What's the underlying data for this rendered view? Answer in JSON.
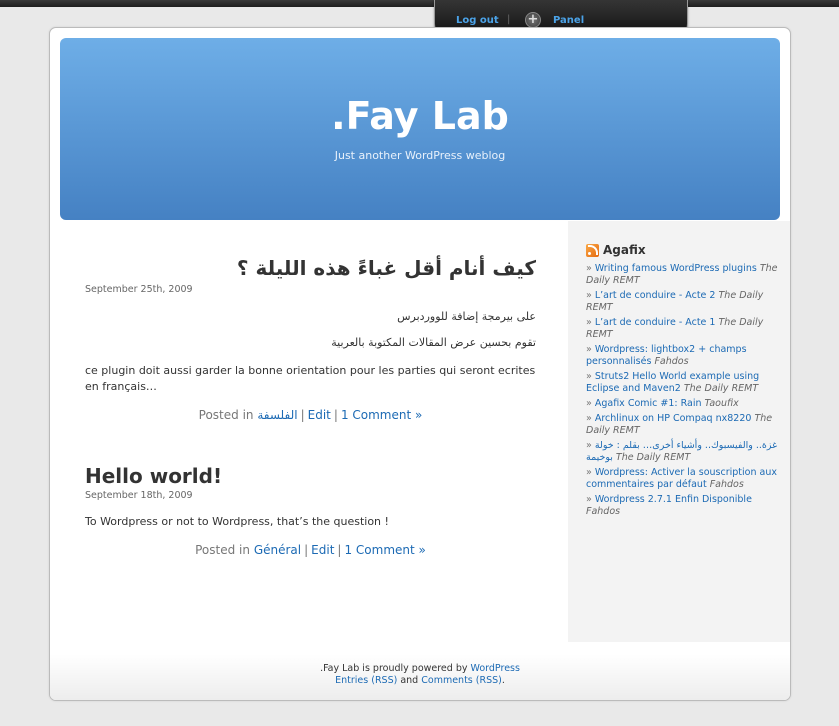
{
  "admin": {
    "logout": "Log out",
    "separator": "|",
    "panel": "Panel"
  },
  "header": {
    "title": ".Fay Lab",
    "description": "Just another WordPress weblog"
  },
  "posts": [
    {
      "title": "كيف أنام أقل غباءً هذه الليلة ؟",
      "date": "September 25th, 2009",
      "paragraphs": [
        "على بيرمجة إضافة للووردبرس",
        "تقوم بحسين عرض المقالات المكتوبة بالعربية",
        "ce plugin doit aussi garder la bonne orientation pour les parties qui seront ecrites en français…"
      ],
      "meta": {
        "posted_in": "Posted in",
        "category": "الفلسفة",
        "edit": "Edit",
        "comments": "1 Comment »"
      }
    },
    {
      "title": "Hello world!",
      "date": "September 18th, 2009",
      "paragraphs": [
        "To Wordpress or not to Wordpress, that’s the question !"
      ],
      "meta": {
        "posted_in": "Posted in",
        "category": "Général",
        "edit": "Edit",
        "comments": "1 Comment »"
      }
    }
  ],
  "sidebar": {
    "widget_title": "Agafix",
    "items": [
      {
        "title": "Writing famous WordPress plugins",
        "source": "The Daily REMT"
      },
      {
        "title": "L’art de conduire - Acte 2",
        "source": "The Daily REMT"
      },
      {
        "title": "L’art de conduire - Acte 1",
        "source": "The Daily REMT"
      },
      {
        "title": "Wordpress: lightbox2 + champs personnalisés",
        "source": "Fahdos"
      },
      {
        "title": "Struts2 Hello World example using Eclipse and Maven2",
        "source": "The Daily REMT"
      },
      {
        "title": "Agafix Comic #1: Rain",
        "source": "Taoufix"
      },
      {
        "title": "Archlinux on HP Compaq nx8220",
        "source": "The Daily REMT"
      },
      {
        "title": "غزة.. والفيسبوك.. وأشياء أخرى… بقلم : خولة بوخيمة",
        "source": "The Daily REMT"
      },
      {
        "title": "Wordpress: Activer la souscription aux commentaires par défaut",
        "source": "Fahdos"
      },
      {
        "title": "Wordpress 2.7.1 Enfin Disponible",
        "source": "Fahdos"
      }
    ]
  },
  "footer": {
    "line1_text": ".Fay Lab is proudly powered by",
    "wordpress": "WordPress",
    "entries_rss": "Entries (RSS)",
    "and": "and",
    "comments_rss": "Comments (RSS)",
    "period": "."
  }
}
